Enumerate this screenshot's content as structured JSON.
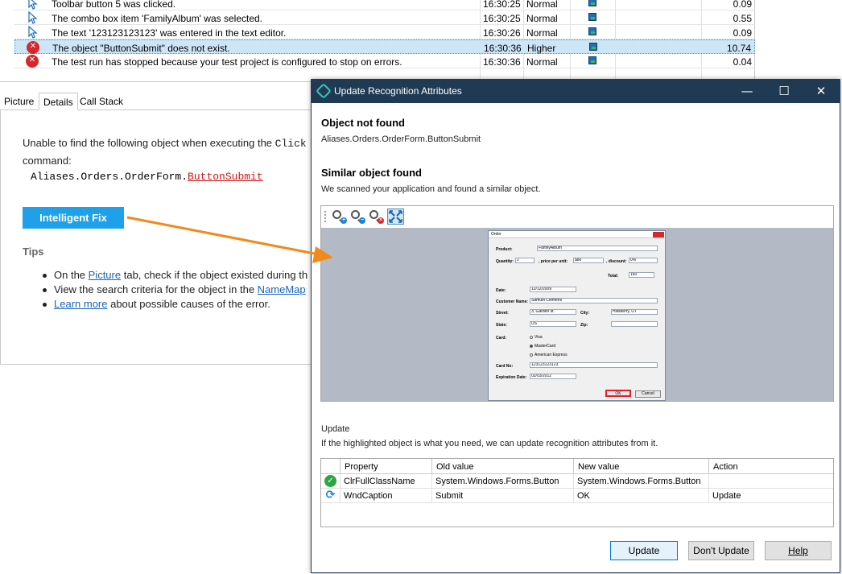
{
  "log": {
    "rows": [
      {
        "message": "Toolbar button 5 was clicked.",
        "time": "16:30:25",
        "priority": "Normal",
        "duration": "0.09",
        "type": "action"
      },
      {
        "message": "The combo box item 'FamilyAlbum' was selected.",
        "time": "16:30:25",
        "priority": "Normal",
        "duration": "0.55",
        "type": "action"
      },
      {
        "message": "The text '123123123123' was entered in the text editor.",
        "time": "16:30:26",
        "priority": "Normal",
        "duration": "0.09",
        "type": "action"
      },
      {
        "message": "The object \"ButtonSubmit\" does not exist.",
        "time": "16:30:36",
        "priority": "Higher",
        "duration": "10.74",
        "type": "error"
      },
      {
        "message": "The test run has stopped because your test project is configured to stop on errors.",
        "time": "16:30:36",
        "priority": "Normal",
        "duration": "0.04",
        "type": "error"
      }
    ]
  },
  "tabs": [
    "Picture",
    "Details",
    "Call Stack"
  ],
  "details": {
    "line1": "Unable to find the following object when executing the",
    "line1_code": "Click",
    "line2": "command:",
    "code_prefix": "Aliases.Orders.OrderForm.",
    "code_object": "ButtonSubmit",
    "fix_button": "Intelligent Fix",
    "tips_title": "Tips",
    "tip1_pre": "On the ",
    "tip1_link": "Picture",
    "tip1_post": " tab, check if the object existed during th",
    "tip2_pre": "View the search criteria for the object in the ",
    "tip2_link": "NameMap",
    "tip3_link": "Learn more",
    "tip3_post": " about possible causes of the error."
  },
  "dialog": {
    "title": "Update Recognition Attributes",
    "minimize": "—",
    "maximize": "☐",
    "close": "✕",
    "not_found_title": "Object not found",
    "not_found_path": "Aliases.Orders.OrderForm.ButtonSubmit",
    "similar_title": "Similar object found",
    "similar_text": "We scanned your application and found a similar object.",
    "update_label": "Update",
    "update_text": "If the highlighted object is what you need, we can update recognition attributes from it.",
    "columns": [
      "Property",
      "Old value",
      "New value",
      "Action"
    ],
    "rows": [
      {
        "status": "ok",
        "property": "ClrFullClassName",
        "old": "System.Windows.Forms.Button",
        "new": "System.Windows.Forms.Button",
        "action": ""
      },
      {
        "status": "sync",
        "property": "WndCaption",
        "old": "Submit",
        "new": "OK",
        "action": "Update"
      }
    ],
    "buttons": {
      "update": "Update",
      "dont_update": "Don't Update",
      "help": "Help"
    }
  },
  "preview": {
    "title": "Order",
    "product_label": "Product:",
    "product_value": "FamilyAlbum",
    "quantity_label": "Quantity:",
    "quantity_value": "2",
    "price_label": ", price per unit:",
    "price_value": "$80",
    "discount_label": ", discount:",
    "discount_value": "0%",
    "total_label": "Total:",
    "total_value": "160",
    "date_label": "Date:",
    "date_value": "12/12/2009",
    "customer_label": "Customer Name:",
    "customer_value": "Samuel Clemens",
    "street_label": "Street:",
    "street_value": "3, Garden st.",
    "city_label": "City:",
    "city_value": "Hillsberry, UT",
    "state_label": "State:",
    "state_value": "US",
    "zip_label": "Zip:",
    "zip_value": "",
    "card_label": "Card:",
    "card_options": [
      "Visa",
      "MasterCard",
      "American Express"
    ],
    "cardno_label": "Card No:",
    "cardno_value": "123123123123",
    "exp_label": "Expiration Date:",
    "exp_value": "02/03/2012",
    "ok": "OK",
    "cancel": "Cancel"
  },
  "colors": {
    "accent": "#1ea0ea",
    "arrow": "#f08a1c",
    "error": "#d9262c",
    "titlebar": "#1f3a52"
  }
}
